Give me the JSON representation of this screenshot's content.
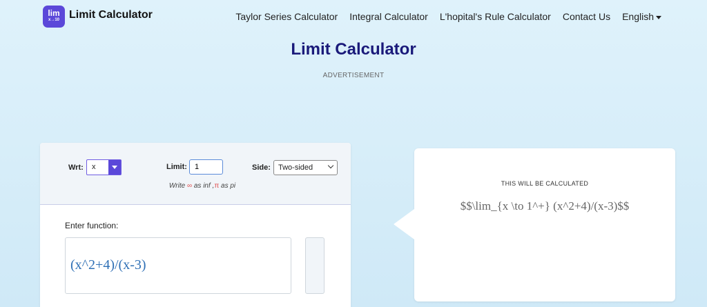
{
  "nav": {
    "logo_top": "lim",
    "logo_bottom": "x→10",
    "brand": "Limit Calculator",
    "links": [
      "Taylor Series Calculator",
      "Integral Calculator",
      "L'hopital's Rule Calculator",
      "Contact Us"
    ],
    "language": "English"
  },
  "page": {
    "title": "Limit Calculator",
    "advertisement": "ADVERTISEMENT"
  },
  "options": {
    "wrt_label": "Wrt:",
    "wrt_value": "x",
    "limit_label": "Limit:",
    "limit_value": "1",
    "side_label": "Side:",
    "side_value": "Two-sided",
    "hint_prefix": "Write",
    "hint_inf_symbol": "∞",
    "hint_inf_text": "as inf ,",
    "hint_pi_symbol": "π",
    "hint_pi_text": "as pi"
  },
  "input": {
    "label": "Enter function:",
    "expression": "(x^2+4)/(x-3)"
  },
  "preview": {
    "label": "THIS WILL BE CALCULATED",
    "expression": "$$\\lim_{x \\to 1^+} (x^2+4)/(x-3)$$"
  },
  "colors": {
    "accent": "#5b48d9",
    "title": "#1a1a7a",
    "expression": "#2e6fb5"
  }
}
